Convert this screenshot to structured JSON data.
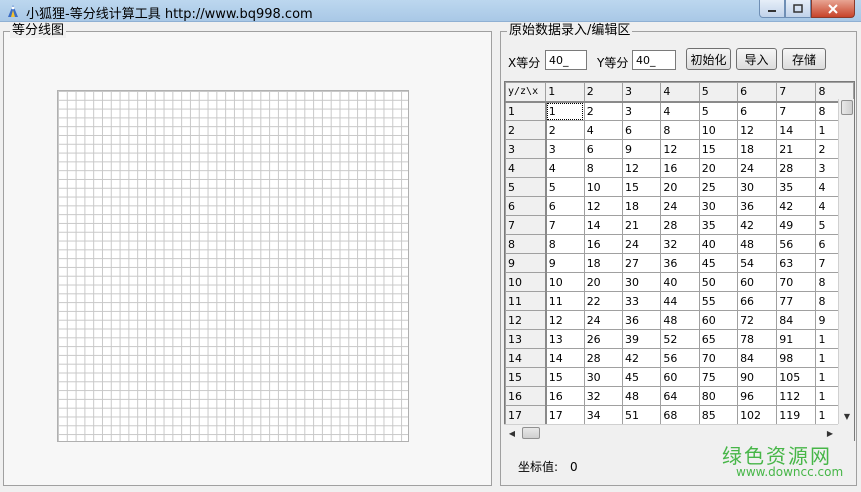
{
  "window": {
    "title": "小狐狸-等分线计算工具  http://www.bq998.com"
  },
  "left_panel": {
    "title": "等分线图"
  },
  "right_panel": {
    "title": "原始数据录入/编辑区"
  },
  "controls": {
    "x_label": "X等分",
    "x_value": "40_",
    "y_label": "Y等分",
    "y_value": "40_",
    "init_button": "初始化",
    "import_button": "导入",
    "save_button": "存储"
  },
  "table": {
    "corner": "y/z\\x",
    "columns": [
      "1",
      "2",
      "3",
      "4",
      "5",
      "6",
      "7",
      "8"
    ],
    "rows": [
      {
        "head": "1",
        "cells": [
          "1",
          "2",
          "3",
          "4",
          "5",
          "6",
          "7",
          "8"
        ]
      },
      {
        "head": "2",
        "cells": [
          "2",
          "4",
          "6",
          "8",
          "10",
          "12",
          "14",
          "1"
        ]
      },
      {
        "head": "3",
        "cells": [
          "3",
          "6",
          "9",
          "12",
          "15",
          "18",
          "21",
          "2"
        ]
      },
      {
        "head": "4",
        "cells": [
          "4",
          "8",
          "12",
          "16",
          "20",
          "24",
          "28",
          "3"
        ]
      },
      {
        "head": "5",
        "cells": [
          "5",
          "10",
          "15",
          "20",
          "25",
          "30",
          "35",
          "4"
        ]
      },
      {
        "head": "6",
        "cells": [
          "6",
          "12",
          "18",
          "24",
          "30",
          "36",
          "42",
          "4"
        ]
      },
      {
        "head": "7",
        "cells": [
          "7",
          "14",
          "21",
          "28",
          "35",
          "42",
          "49",
          "5"
        ]
      },
      {
        "head": "8",
        "cells": [
          "8",
          "16",
          "24",
          "32",
          "40",
          "48",
          "56",
          "6"
        ]
      },
      {
        "head": "9",
        "cells": [
          "9",
          "18",
          "27",
          "36",
          "45",
          "54",
          "63",
          "7"
        ]
      },
      {
        "head": "10",
        "cells": [
          "10",
          "20",
          "30",
          "40",
          "50",
          "60",
          "70",
          "8"
        ]
      },
      {
        "head": "11",
        "cells": [
          "11",
          "22",
          "33",
          "44",
          "55",
          "66",
          "77",
          "8"
        ]
      },
      {
        "head": "12",
        "cells": [
          "12",
          "24",
          "36",
          "48",
          "60",
          "72",
          "84",
          "9"
        ]
      },
      {
        "head": "13",
        "cells": [
          "13",
          "26",
          "39",
          "52",
          "65",
          "78",
          "91",
          "1"
        ]
      },
      {
        "head": "14",
        "cells": [
          "14",
          "28",
          "42",
          "56",
          "70",
          "84",
          "98",
          "1"
        ]
      },
      {
        "head": "15",
        "cells": [
          "15",
          "30",
          "45",
          "60",
          "75",
          "90",
          "105",
          "1"
        ]
      },
      {
        "head": "16",
        "cells": [
          "16",
          "32",
          "48",
          "64",
          "80",
          "96",
          "112",
          "1"
        ]
      },
      {
        "head": "17",
        "cells": [
          "17",
          "34",
          "51",
          "68",
          "85",
          "102",
          "119",
          "1"
        ]
      },
      {
        "head": "",
        "cells": [
          "",
          "",
          "",
          "",
          "",
          "",
          "",
          ""
        ]
      }
    ]
  },
  "coord": {
    "label": "坐标值:",
    "value": "0"
  },
  "watermark": {
    "name": "绿色资源网",
    "url": "www.downcc.com"
  }
}
